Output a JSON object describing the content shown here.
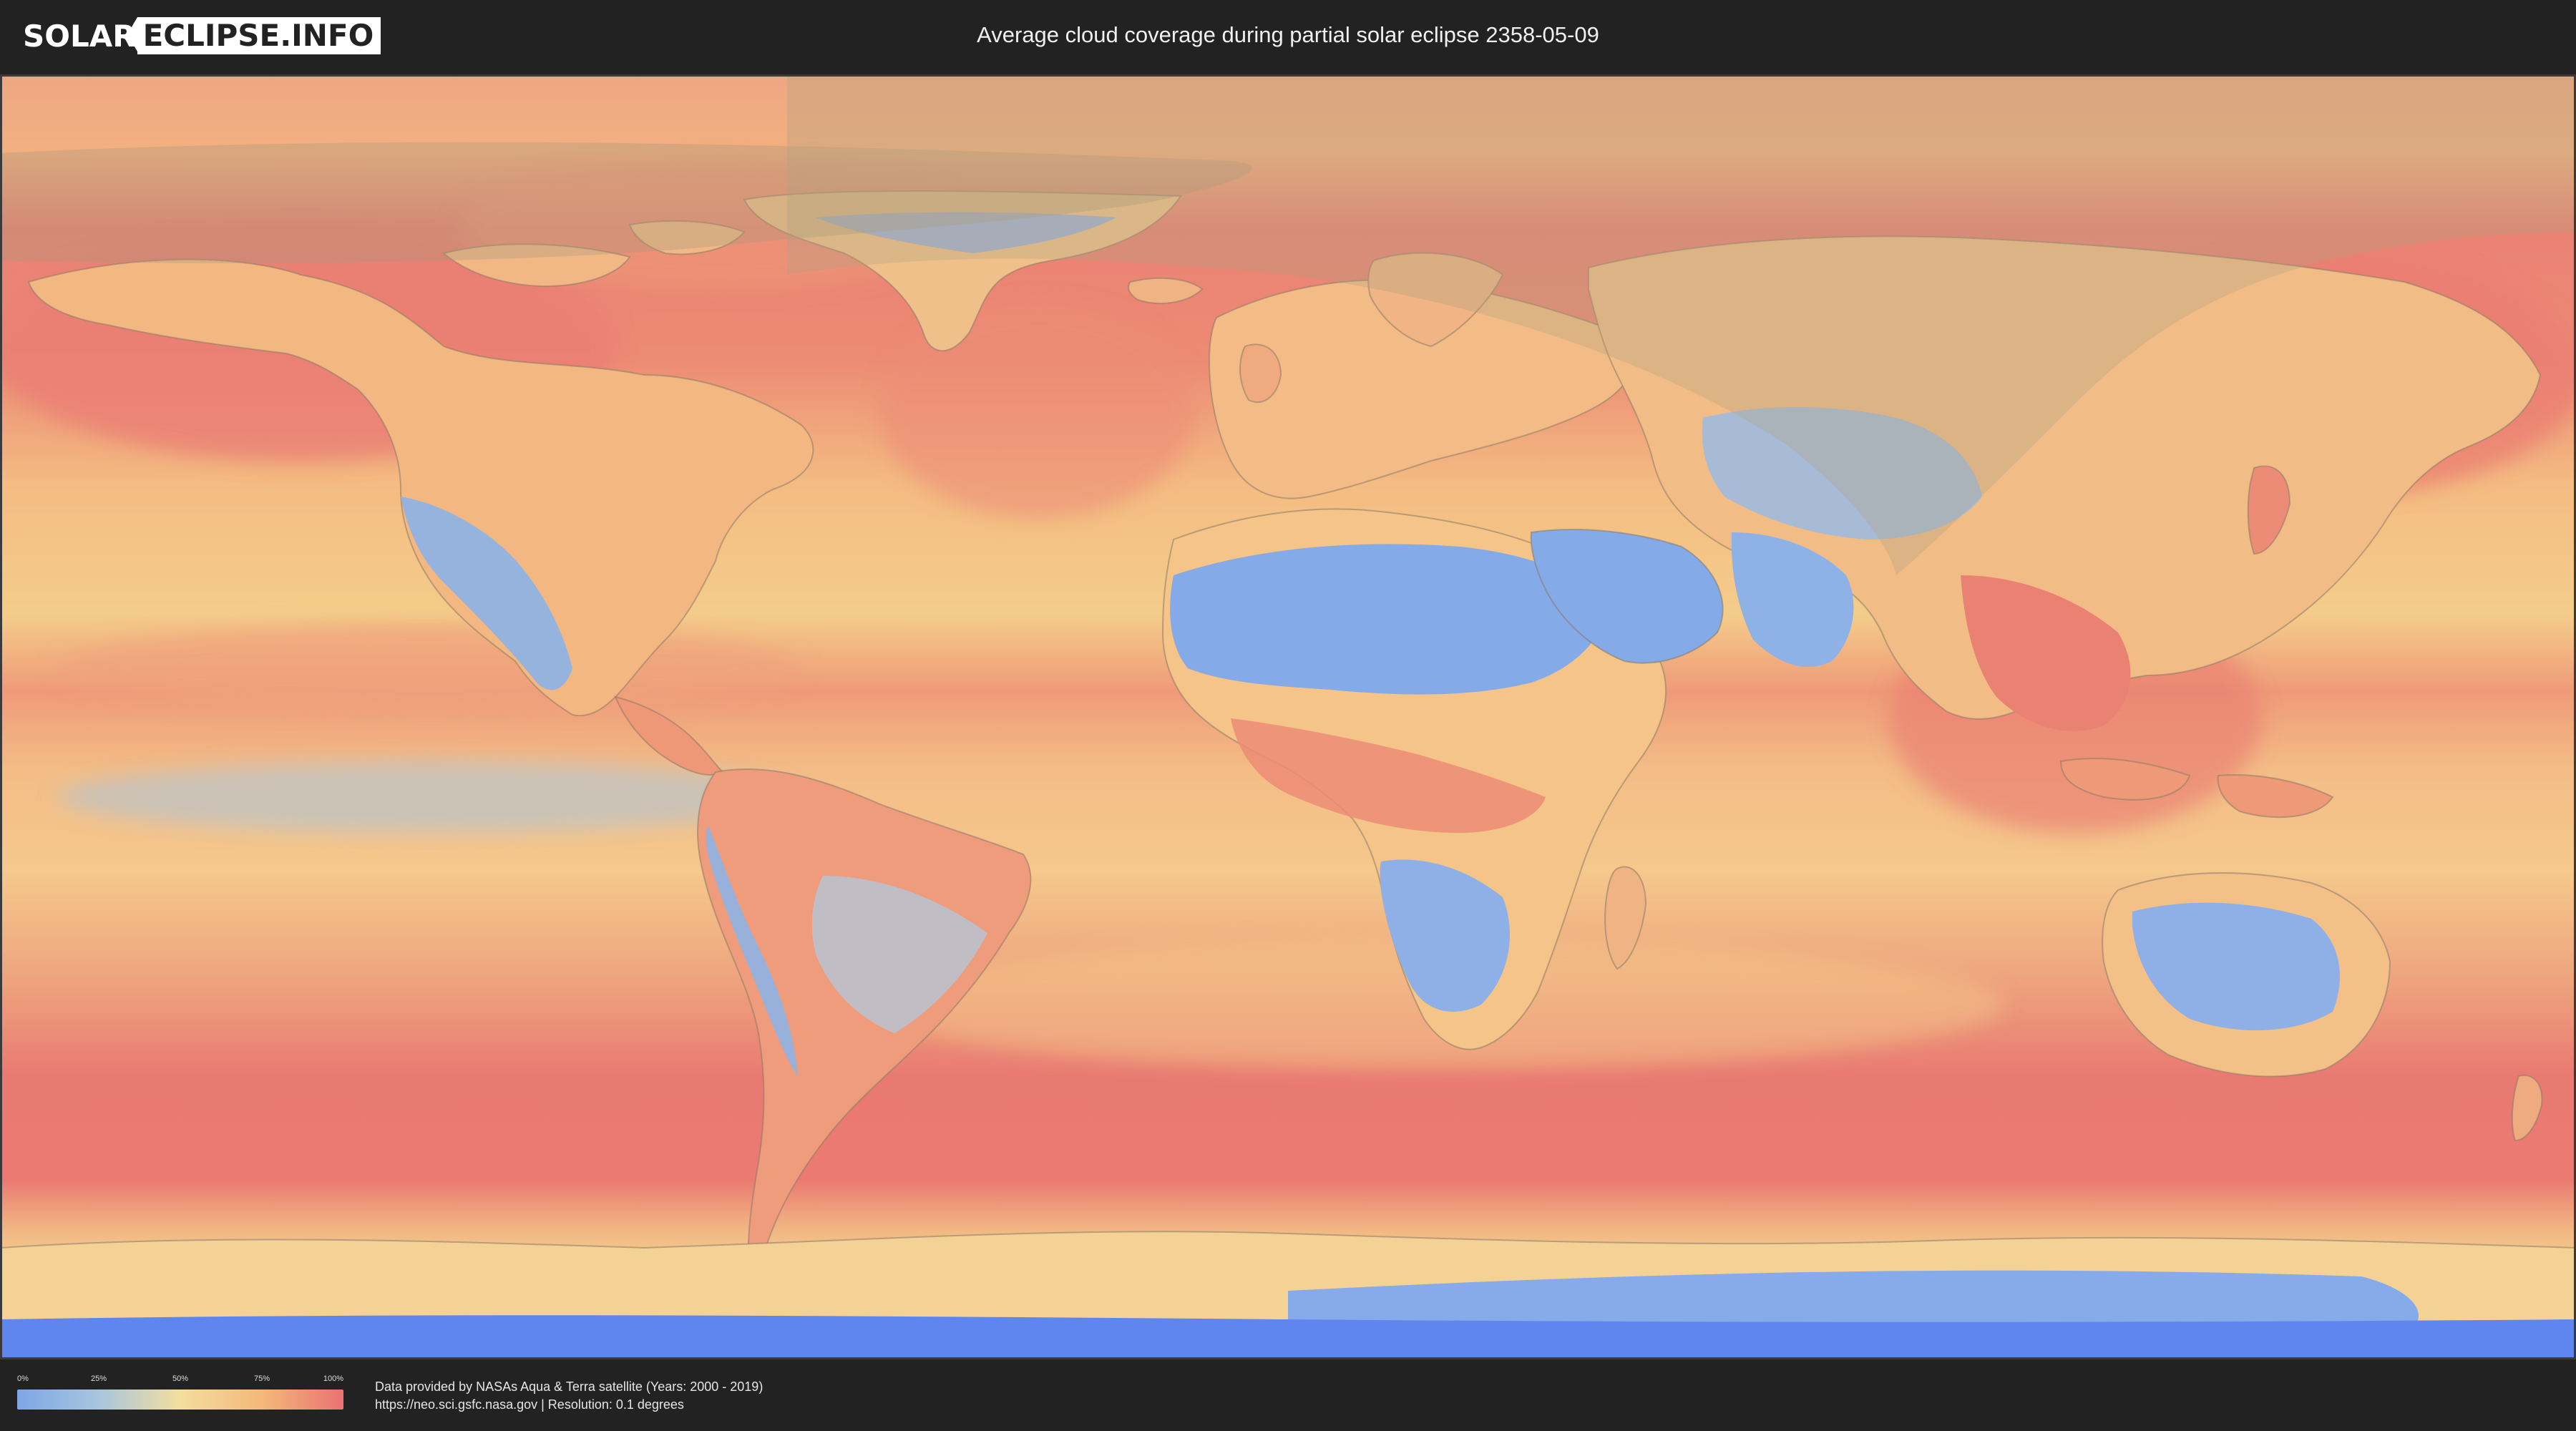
{
  "header": {
    "logo_left": "SOLAR",
    "logo_right": "ECLIPSE.INFO",
    "title": "Average cloud coverage during partial solar eclipse 2358-05-09"
  },
  "map": {
    "projection": "equirectangular",
    "colors": {
      "clear": "#7ea6e6",
      "quarter": "#a8c6de",
      "half": "#f4de9f",
      "three_quarter": "#f4b87a",
      "overcast": "#ea7272",
      "eclipse_shadow_overlay": "#b0a080",
      "frame": "#3a3a3a"
    },
    "eclipse_region": "partial eclipse visibility zone over northern Asia and the North Atlantic"
  },
  "legend": {
    "ticks": [
      "0%",
      "25%",
      "50%",
      "75%",
      "100%"
    ],
    "gradient": [
      "#7ea6e6",
      "#a8c6de",
      "#f4de9f",
      "#f4b87a",
      "#ea7272"
    ]
  },
  "credits": {
    "line1": "Data provided by NASAs Aqua & Terra satellite (Years: 2000 - 2019)",
    "line2": "https://neo.sci.gsfc.nasa.gov | Resolution: 0.1 degrees"
  }
}
